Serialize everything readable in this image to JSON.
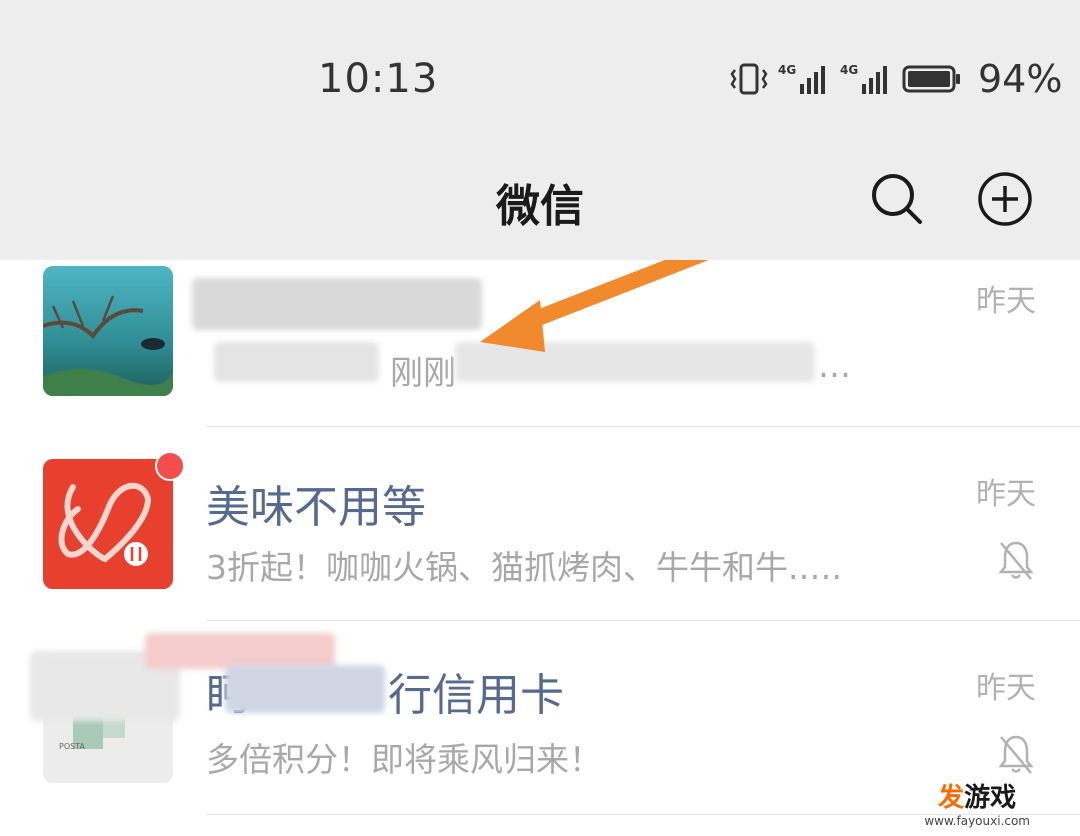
{
  "statusbar": {
    "time": "10:13",
    "battery": "94%",
    "icons": [
      "vibrate-icon",
      "signal-4g-icon",
      "signal-4g-icon",
      "battery-icon"
    ]
  },
  "nav": {
    "title": "微信",
    "search_icon": "search-icon",
    "add_icon": "plus-circle-icon"
  },
  "chats": [
    {
      "name": "",
      "preview": "刚刚",
      "time": "昨天",
      "avatar": "underwater-photo",
      "muted": false,
      "unread_dot": false,
      "redacted": true
    },
    {
      "name": "美味不用等",
      "preview": "3折起！咖咖火锅、猫抓烤肉、牛牛和牛.….",
      "time": "昨天",
      "avatar": "meiwei-logo",
      "muted": true,
      "unread_dot": true
    },
    {
      "name": "行信用卡",
      "preview": "多倍积分！即将乘风归来！",
      "time": "昨天",
      "avatar": "bank-logo",
      "muted": true,
      "unread_dot": true,
      "redacted": true
    }
  ],
  "watermark": {
    "title_accent": "发",
    "title_rest": "游戏",
    "url": "www.fayouxi.com"
  },
  "colors": {
    "header_bg": "#ededed",
    "name": "#56698f",
    "preview": "#a8a8a8",
    "arrow": "#f08a2c",
    "red_dot": "#f44d4d"
  }
}
